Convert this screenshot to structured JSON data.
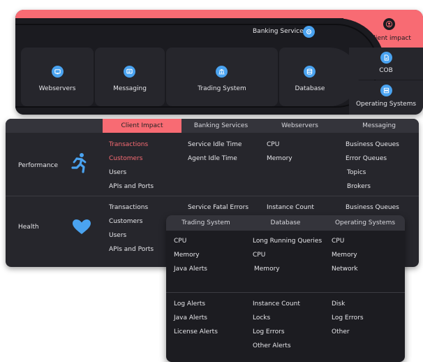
{
  "top": {
    "banking_label": "Banking Services",
    "right_col": {
      "client_impact": "Client impact",
      "cob": "COB",
      "operating_systems": "Operating Systems"
    },
    "services": [
      {
        "label": "Webservers",
        "icon": "monitor-icon"
      },
      {
        "label": "Messaging",
        "icon": "chat-icon"
      },
      {
        "label": "Trading System",
        "icon": "bank-icon"
      },
      {
        "label": "Database",
        "icon": "database-icon"
      }
    ]
  },
  "main_tabs": [
    "Client Impact",
    "Banking Services",
    "Webservers",
    "Messaging"
  ],
  "sections": {
    "performance": {
      "label": "Performance",
      "col1": [
        "Transactions",
        "Customers",
        "Users",
        "APIs and Ports"
      ],
      "col2": [
        "Service Idle Time",
        "Agent Idle Time"
      ],
      "col3": [
        "CPU",
        "Memory"
      ],
      "col4": [
        "Business Queues",
        "Error Queues",
        "Topics",
        "Brokers"
      ]
    },
    "health": {
      "label": "Health",
      "col1": [
        "Transactions",
        "Customers",
        "Users",
        "APIs and Ports"
      ],
      "col2": [
        "Service Fatal Errors"
      ],
      "col3": [
        "Instance Count"
      ],
      "col4": [
        "Business Queues"
      ]
    }
  },
  "overlay": {
    "tabs": [
      "Trading System",
      "Database",
      "Operating Systems"
    ],
    "performance": {
      "col1": [
        "CPU",
        "Memory",
        "Java Alerts"
      ],
      "col2": [
        "Long Running Queries",
        "CPU",
        "Memory"
      ],
      "col3": [
        "CPU",
        "Memory",
        "Network"
      ]
    },
    "health": {
      "col1": [
        "Log Alerts",
        "Java Alerts",
        "License Alerts"
      ],
      "col2": [
        "Instance Count",
        "Locks",
        "Log Errors",
        "Other Alerts"
      ],
      "col3": [
        "Disk",
        "Log Errors",
        "Other"
      ]
    }
  },
  "colors": {
    "accent": "#f86b73",
    "icon_blue": "#4aa3f0",
    "panel_dark": "#1b1b20",
    "panel": "#26262c"
  }
}
